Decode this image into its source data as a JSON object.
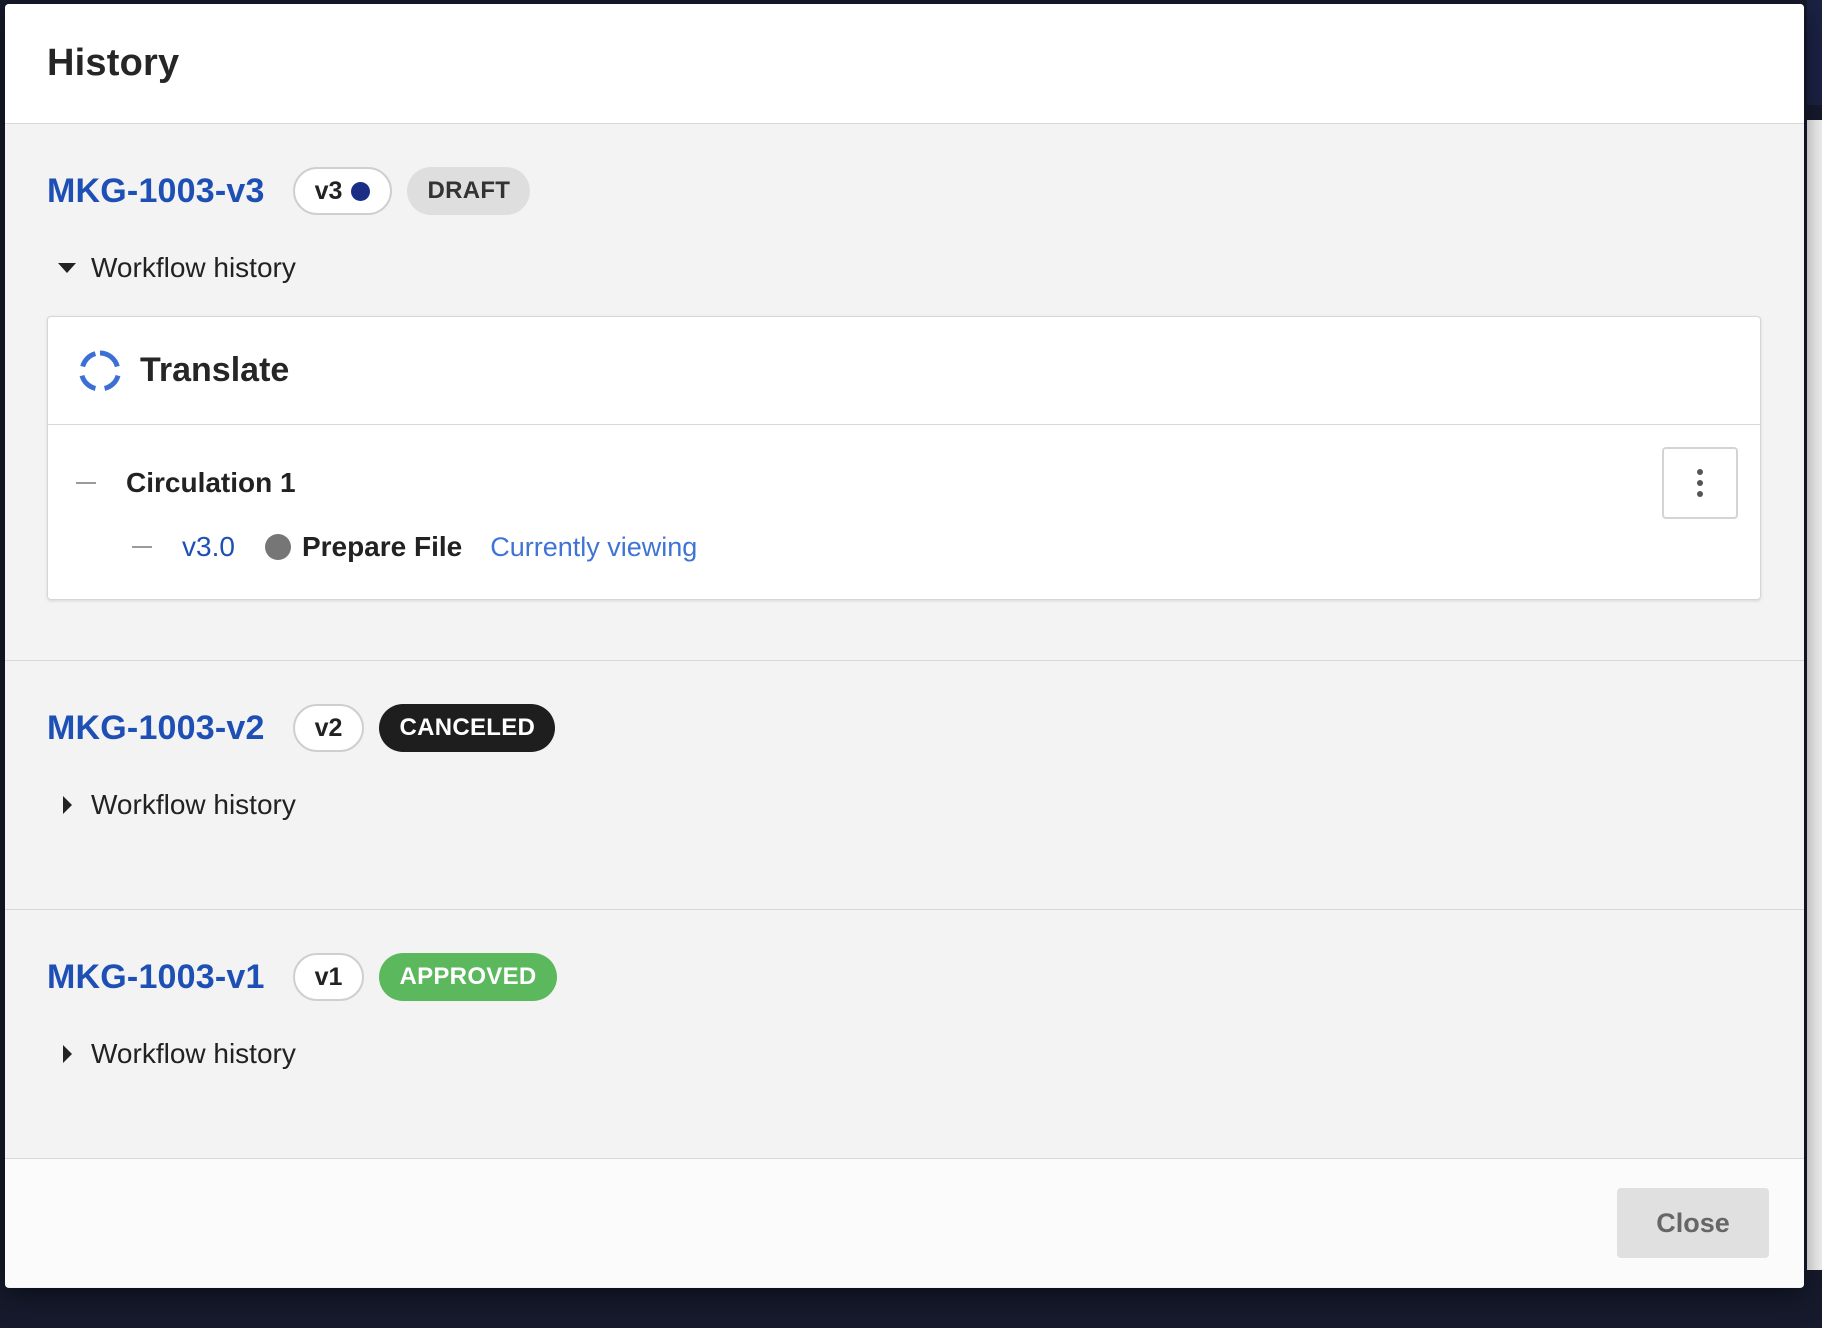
{
  "dialog": {
    "title": "History"
  },
  "versions": [
    {
      "doc_name": "MKG-1003-v3",
      "version_label": "v3",
      "status": "DRAFT",
      "workflow_toggle": "Workflow history",
      "expanded": true,
      "workflow": {
        "name": "Translate",
        "circulation_label": "Circulation 1",
        "step": {
          "version": "v3.0",
          "name": "Prepare File",
          "viewing_label": "Currently viewing"
        }
      }
    },
    {
      "doc_name": "MKG-1003-v2",
      "version_label": "v2",
      "status": "CANCELED",
      "workflow_toggle": "Workflow history",
      "expanded": false
    },
    {
      "doc_name": "MKG-1003-v1",
      "version_label": "v1",
      "status": "APPROVED",
      "workflow_toggle": "Workflow history",
      "expanded": false
    }
  ],
  "footer": {
    "close_label": "Close"
  },
  "colors": {
    "link": "#1e4fb5",
    "draft": "#dedede",
    "canceled": "#1e1e1e",
    "approved": "#5cb85c",
    "current_dot": "#1a2e86",
    "step_dot": "#767676"
  },
  "icons": {
    "workflow": "circular-arrows-icon",
    "menu": "kebab-menu-icon",
    "expanded": "caret-down-icon",
    "collapsed": "caret-right-icon"
  }
}
